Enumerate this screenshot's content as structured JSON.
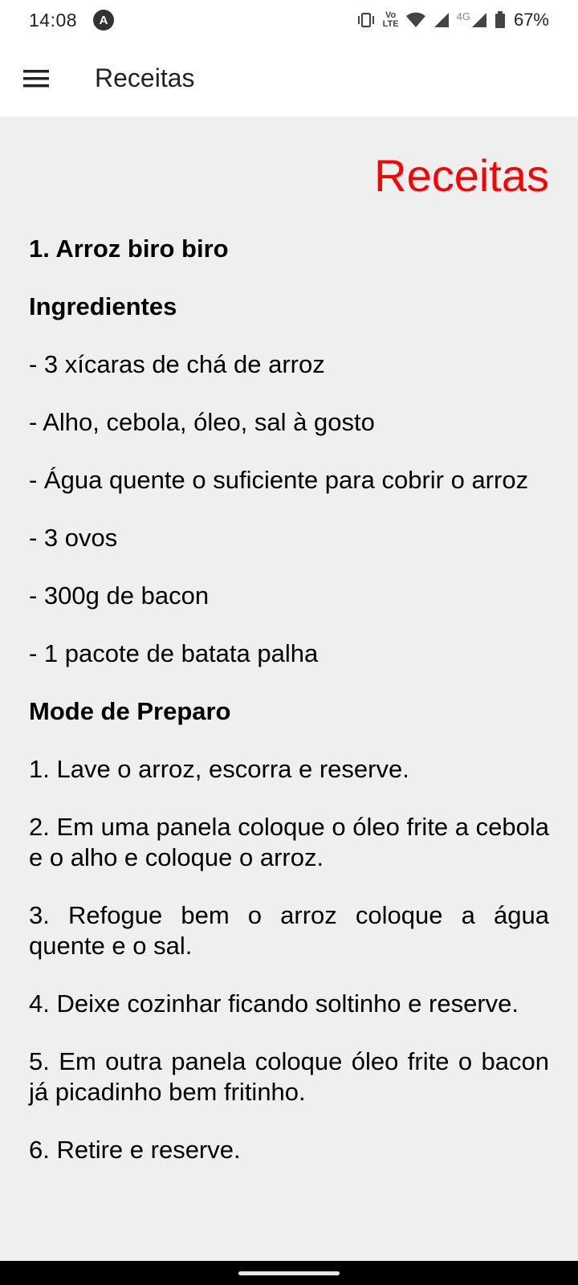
{
  "status_bar": {
    "time": "14:08",
    "app_notification_glyph": "A",
    "volte_label_top": "Vo",
    "volte_label_bottom": "LTE",
    "network_label": "4G",
    "battery_percent": "67%",
    "icons": [
      "vibrate-icon",
      "wifi-icon",
      "signal-icon",
      "battery-icon"
    ]
  },
  "app_bar": {
    "title": "Receitas",
    "menu_icon": "hamburger-menu-icon"
  },
  "content": {
    "heading": "Receitas",
    "heading_color": "#ff0000",
    "recipe_title": "1. Arroz biro biro",
    "ingredients_title": "Ingredientes",
    "ingredients": [
      "- 3 xícaras de chá de arroz",
      "- Alho, cebola, óleo, sal à gosto",
      "- Água quente o suficiente para cobrir o arroz",
      "- 3 ovos",
      "- 300g de bacon",
      "- 1 pacote de batata palha"
    ],
    "preparation_title": "Mode de Preparo",
    "steps": [
      "1. Lave o arroz, escorra e reserve.",
      "2. Em uma panela coloque o óleo frite a cebola e o alho e coloque o arroz.",
      "3. Refogue bem o arroz coloque a água quente e o sal.",
      "4. Deixe cozinhar ficando soltinho e reserve.",
      "5. Em outra panela coloque óleo frite o bacon já picadinho bem fritinho.",
      "6. Retire e reserve."
    ]
  }
}
